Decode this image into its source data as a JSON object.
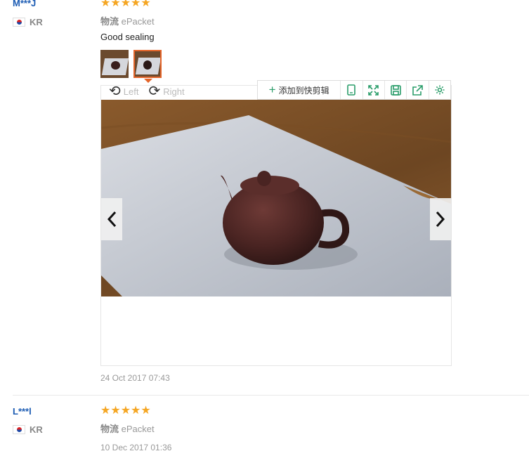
{
  "reviews": [
    {
      "user": "M***J",
      "country": "KR",
      "rating": "★★★★★",
      "logistics_label": "物流",
      "logistics_value": "ePacket",
      "comment": "Good sealing",
      "date": "24 Oct 2017 07:43"
    },
    {
      "user": "L***l",
      "country": "KR",
      "rating": "★★★★★",
      "logistics_label": "物流",
      "logistics_value": "ePacket",
      "date": "10 Dec 2017 01:36"
    }
  ],
  "viewer": {
    "rotate_left": "Left",
    "rotate_right": "Right",
    "prev_icon": "chevron-left-icon",
    "next_icon": "chevron-right-icon"
  },
  "toolbar": {
    "add_clip": "添加到快剪辑",
    "icons": [
      "phone-icon",
      "fullscreen-icon",
      "save-icon",
      "share-icon",
      "gear-icon"
    ]
  },
  "colors": {
    "username": "#1b5bb3",
    "star": "#f5a623",
    "selected_thumb_border": "#e4652a",
    "toolbar_icon": "#2a9d6a"
  }
}
